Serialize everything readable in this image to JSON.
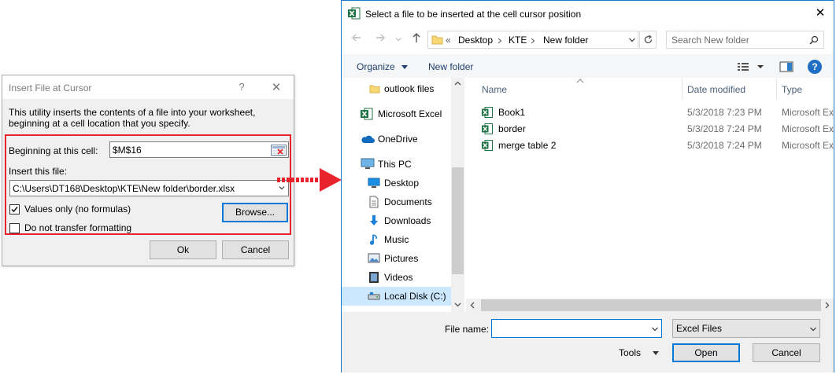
{
  "insert_dialog": {
    "title": "Insert File at Cursor",
    "help": "?",
    "close": "✕",
    "description": "This utility inserts the contents of a file into your worksheet, beginning at a cell location that you specify.",
    "beginning_label": "Beginning at this cell:",
    "beginning_value": "$M$16",
    "insert_label": "Insert this file:",
    "insert_value": "C:\\Users\\DT168\\Desktop\\KTE\\New folder\\border.xlsx",
    "browse_label": "Browse...",
    "values_only_label": "Values only (no formulas)",
    "values_only_checked": true,
    "no_format_label": "Do not transfer formatting",
    "no_format_checked": false,
    "ok_label": "Ok",
    "cancel_label": "Cancel",
    "highlight_color": "#e8232b"
  },
  "open_dialog": {
    "title": "Select a file to be inserted at the cell cursor position",
    "close": "✕",
    "breadcrumb": [
      "«",
      "Desktop",
      "KTE",
      "New folder"
    ],
    "search_placeholder": "Search New folder",
    "toolbar": {
      "organize": "Organize",
      "new_folder": "New folder",
      "help": "?"
    },
    "nav_items": [
      {
        "label": "outlook files",
        "icon": "folder-icon"
      },
      {
        "label": "Microsoft Excel",
        "icon": "excel-icon"
      },
      {
        "label": "OneDrive",
        "icon": "cloud-icon"
      },
      {
        "label": "This PC",
        "icon": "pc-icon"
      },
      {
        "label": "Desktop",
        "icon": "desktop-icon"
      },
      {
        "label": "Documents",
        "icon": "documents-icon"
      },
      {
        "label": "Downloads",
        "icon": "downloads-icon"
      },
      {
        "label": "Music",
        "icon": "music-icon"
      },
      {
        "label": "Pictures",
        "icon": "pictures-icon"
      },
      {
        "label": "Videos",
        "icon": "videos-icon"
      },
      {
        "label": "Local Disk (C:)",
        "icon": "disk-icon",
        "selected": true
      }
    ],
    "columns": {
      "name": "Name",
      "date": "Date modified",
      "type": "Type"
    },
    "files": [
      {
        "name": "Book1",
        "date": "5/3/2018 7:23 PM",
        "type": "Microsoft Ex"
      },
      {
        "name": "border",
        "date": "5/3/2018 7:24 PM",
        "type": "Microsoft Ex"
      },
      {
        "name": "merge table 2",
        "date": "5/3/2018 7:24 PM",
        "type": "Microsoft Ex"
      }
    ],
    "filename_label": "File name:",
    "filename_value": "",
    "filetype_value": "Excel Files",
    "tools_label": "Tools",
    "open_label": "Open",
    "cancel_label": "Cancel",
    "accent_color": "#0078d7"
  }
}
